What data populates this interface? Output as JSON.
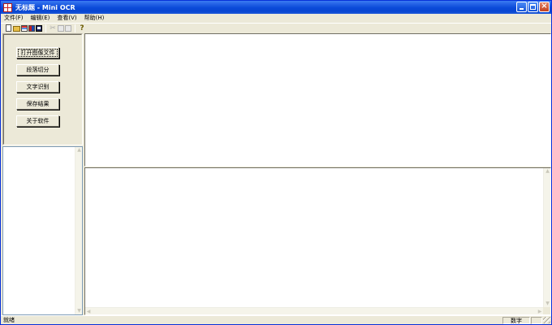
{
  "window": {
    "title": "无标题 - Mini OCR"
  },
  "menu": [
    {
      "label": "文件(F)"
    },
    {
      "label": "编辑(E)"
    },
    {
      "label": "查看(V)"
    },
    {
      "label": "帮助(H)"
    }
  ],
  "toolbar": {
    "icons": [
      "new-icon",
      "open-icon",
      "ocr-icon",
      "segment-icon",
      "save-icon",
      "cut-icon",
      "copy-icon",
      "paste-icon",
      "help-icon"
    ],
    "cut_glyph": "✂",
    "help_glyph": "?"
  },
  "buttons": {
    "open_image": "打开图像文件",
    "segment": "段落切分",
    "recognize": "文字识别",
    "save_result": "保存结果",
    "about": "关于软件"
  },
  "statusbar": {
    "message": "就绪",
    "num_indicator": "数字"
  },
  "colors": {
    "title_bar": "#0a4ad8",
    "face": "#ece9d8",
    "pane": "#ffffff"
  }
}
